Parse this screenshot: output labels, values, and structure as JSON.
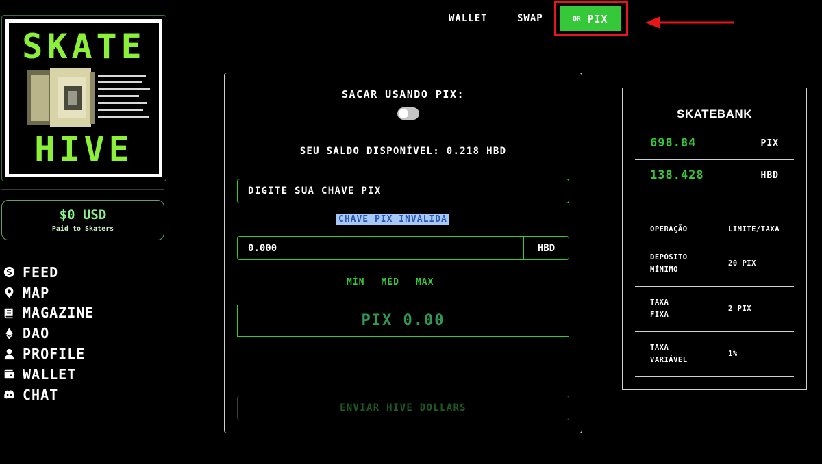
{
  "sidebar": {
    "logo_top": "SKATE",
    "logo_bottom": "HIVE",
    "usd_value": "$0 USD",
    "usd_caption": "Paid to Skaters",
    "nav": [
      {
        "label": "FEED",
        "icon": "skate-coin-icon"
      },
      {
        "label": "MAP",
        "icon": "map-pin-icon"
      },
      {
        "label": "MAGAZINE",
        "icon": "book-icon"
      },
      {
        "label": "DAO",
        "icon": "ethereum-icon"
      },
      {
        "label": "PROFILE",
        "icon": "user-icon"
      },
      {
        "label": "WALLET",
        "icon": "wallet-icon"
      },
      {
        "label": "CHAT",
        "icon": "discord-icon"
      }
    ]
  },
  "topnav": {
    "wallet": "WALLET",
    "swap": "SWAP",
    "pix_flag": "BR",
    "pix": "PIX"
  },
  "colors": {
    "accent": "#35c93a",
    "highlight": "#e8161b",
    "logo_green": "#8cf03a"
  },
  "panel": {
    "toggle_label": "SACAR USANDO PIX:",
    "toggle_on": false,
    "balance_text": "SEU SALDO DISPONÍVEL: 0.218 HBD",
    "key_placeholder": "DIGITE SUA CHAVE PIX",
    "invalid_msg": "CHAVE PIX INVÁLIDA",
    "amount_value": "0.000",
    "amount_currency": "HBD",
    "presets": [
      "MÍN",
      "MÉD",
      "MAX"
    ],
    "pix_result": "PIX 0.00",
    "send_label": "ENVIAR HIVE DOLLARS"
  },
  "bank": {
    "title": "SKATEBANK",
    "balances": [
      {
        "value": "698.84",
        "currency": "PIX"
      },
      {
        "value": "138.428",
        "currency": "HBD"
      }
    ],
    "table_headers": [
      "OPERAÇÃO",
      "LIMITE/TAXA"
    ],
    "rows": [
      {
        "op1": "DEPÓSITO",
        "op2": "MÍNIMO",
        "limit": "20 PIX"
      },
      {
        "op1": "TAXA",
        "op2": "FIXA",
        "limit": "2 PIX"
      },
      {
        "op1": "TAXA",
        "op2": "VARIÁVEL",
        "limit": "1%"
      }
    ]
  }
}
